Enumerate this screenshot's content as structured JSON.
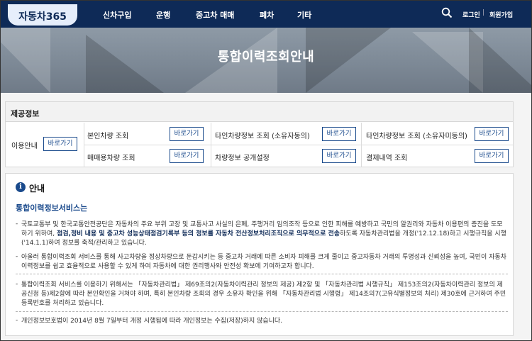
{
  "header": {
    "logo": "자동차365",
    "nav": [
      "신차구입",
      "운행",
      "중고차 매매",
      "폐차",
      "기타"
    ],
    "search_icon": "search-icon",
    "login": "로그인",
    "separator": "|",
    "join": "회원가입",
    "brand_color": "#0e2a57"
  },
  "banner": {
    "title": "통합이력조회안내"
  },
  "provided": {
    "heading": "제공정보",
    "usage_label": "이용안내",
    "usage_button": "바로가기",
    "items": [
      {
        "label": "본인차량 조회",
        "button": "바로가기"
      },
      {
        "label": "타인차량정보 조회 (소유자동의)",
        "button": "바로가기"
      },
      {
        "label": "타인차량정보 조회 (소유자미동의)",
        "button": "바로가기"
      },
      {
        "label": "매매용차량 조회",
        "button": "바로가기"
      },
      {
        "label": "차량정보 공개설정",
        "button": "바로가기"
      },
      {
        "label": "결제내역 조회",
        "button": "바로가기"
      }
    ]
  },
  "notice": {
    "icon": "info-icon",
    "title": "안내",
    "service_title": "통합이력정보서비스는",
    "p1_a": "국토교통부 및 한국교통안전공단은 자동차의 주요 부위 고장 및 교통사고 사실의 은폐, 주행거리 임의조작 등으로 인한 피해를 예방하고 국민의 알권리와 자동차 이용편의 증진을 도모하기 위하여, ",
    "p1_b": "점검,정비 내용 및 중고차 성능상태점검기록부 등의 정보를 자동차 전산정보처리조직으로 의무적으로 전송",
    "p1_c": "하도록 자동차관리법을 개정('12.12.18)하고 시행규칙을 시행('14.1.1)하여 정보를 축적/관리하고 있습니다.",
    "p2": "아울러 통합이력조회 서비스를 통해 사고차량을 정상차량으로 둔갑시키는 등 중고차 거래에 따른 소비자 피해를 크게 줄이고 중고자동차 거래의 투명성과 신뢰성을 높여, 국민이 자동차 이력정보를 쉽고 효율적으로 사용할 수 있게 하여 자동차에 대한 권리행사와 안전성 확보에 기여하고자 합니다.",
    "p3": "통합이력조회 서비스를 이용하기 위해서는 「자동차관리법」 제69조의2(자동차이력관리 정보의 제공) 제2항 및 「자동차관리법 시행규칙」 제153조의2(자동차이력관리 정보의 제공신청 등)제2항에 따라 본인확인을 거쳐야 하며, 특히 본인차량 조회의 경우 소유자 확인을 위해 「자동차관리법 시행령」 제14조의7(고유식별정보의 처리) 제30호에 근거하여 주민등록번호를 처리하고 있습니다.",
    "p4": "개인정보보호법이 2014년 8월 7일부터 개정 시행됨에 따라 개인정보는 수집(저장)하지 않습니다.",
    "bullet": "-"
  }
}
